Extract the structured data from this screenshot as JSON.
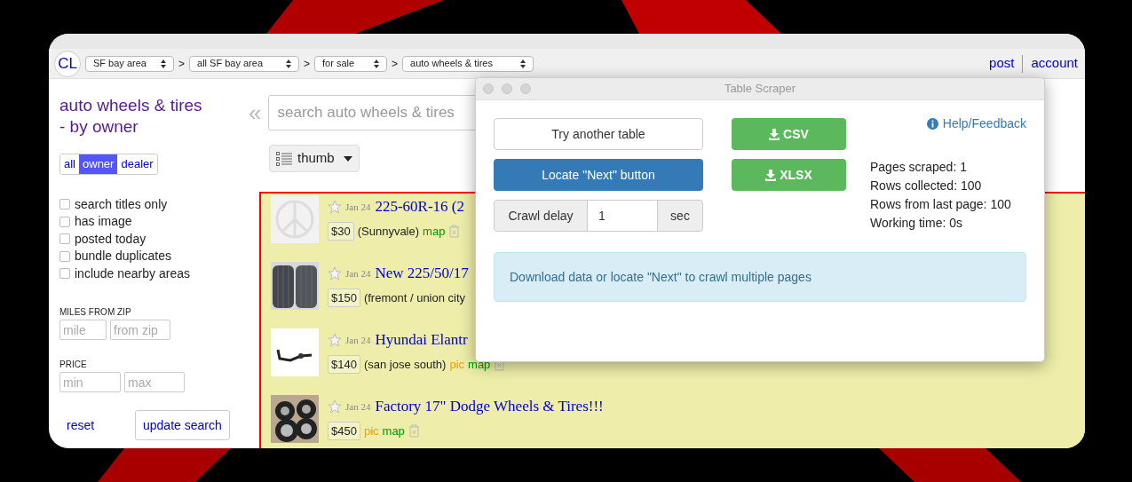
{
  "nav": {
    "logo": "CL",
    "crumbs": [
      {
        "kind": "select",
        "label": "SF bay area"
      },
      {
        "kind": "separator",
        "label": ">"
      },
      {
        "kind": "select",
        "label": "all SF bay area"
      },
      {
        "kind": "separator",
        "label": ">"
      },
      {
        "kind": "select",
        "label": "for sale"
      },
      {
        "kind": "separator",
        "label": ">"
      },
      {
        "kind": "select",
        "label": "auto wheels & tires"
      }
    ],
    "links": [
      "post",
      "account"
    ]
  },
  "sidebar": {
    "title": "auto wheels & tires - by owner",
    "filters": [
      {
        "label": "all",
        "selected": false
      },
      {
        "label": "owner",
        "selected": true
      },
      {
        "label": "dealer",
        "selected": false
      }
    ],
    "checkboxes": [
      {
        "label": "search titles only",
        "checked": false
      },
      {
        "label": "has image",
        "checked": false
      },
      {
        "label": "posted today",
        "checked": false
      },
      {
        "label": "bundle duplicates",
        "checked": false
      },
      {
        "label": "include nearby areas",
        "checked": false
      }
    ],
    "miles": {
      "label": "MILES FROM ZIP",
      "placeholders": [
        "mile",
        "from zip"
      ]
    },
    "price": {
      "label": "PRICE",
      "placeholders": [
        "min",
        "max"
      ]
    },
    "reset": "reset",
    "update": "update search"
  },
  "search": {
    "chevron": "«",
    "placeholder": "search auto wheels & tires",
    "view": "thumb"
  },
  "listings": [
    {
      "date": "Jan 24",
      "title": "225-60R-16 (2",
      "price": "$30",
      "location": "(Sunnyvale)",
      "map": "map",
      "hide_icon": true
    },
    {
      "date": "Jan 24",
      "title": "New 225/50/17",
      "price": "$150",
      "location": "(fremont / union city",
      "hide_icon": false
    },
    {
      "date": "Jan 24",
      "title": "Hyundai Elantr",
      "price": "$140",
      "location": "(san jose south)",
      "pic": "pic",
      "map": "map",
      "hide_icon": true
    },
    {
      "date": "Jan 24",
      "title": "Factory 17\" Dodge Wheels & Tires!!!",
      "price": "$450",
      "pic": "pic",
      "map": "map",
      "hide_icon": true
    }
  ],
  "scraper": {
    "title": "Table Scraper",
    "try_button": "Try another table",
    "locate_button": "Locate \"Next\" button",
    "csv": "CSV",
    "xlsx": "XLSX",
    "help": "Help/Feedback",
    "delay": {
      "label": "Crawl delay",
      "value": "1",
      "unit": "sec"
    },
    "stats": [
      "Pages scraped: 1",
      "Rows collected: 100",
      "Rows from last page: 100",
      "Working time: 0s"
    ],
    "info": "Download data or locate \"Next\" to crawl multiple pages"
  }
}
